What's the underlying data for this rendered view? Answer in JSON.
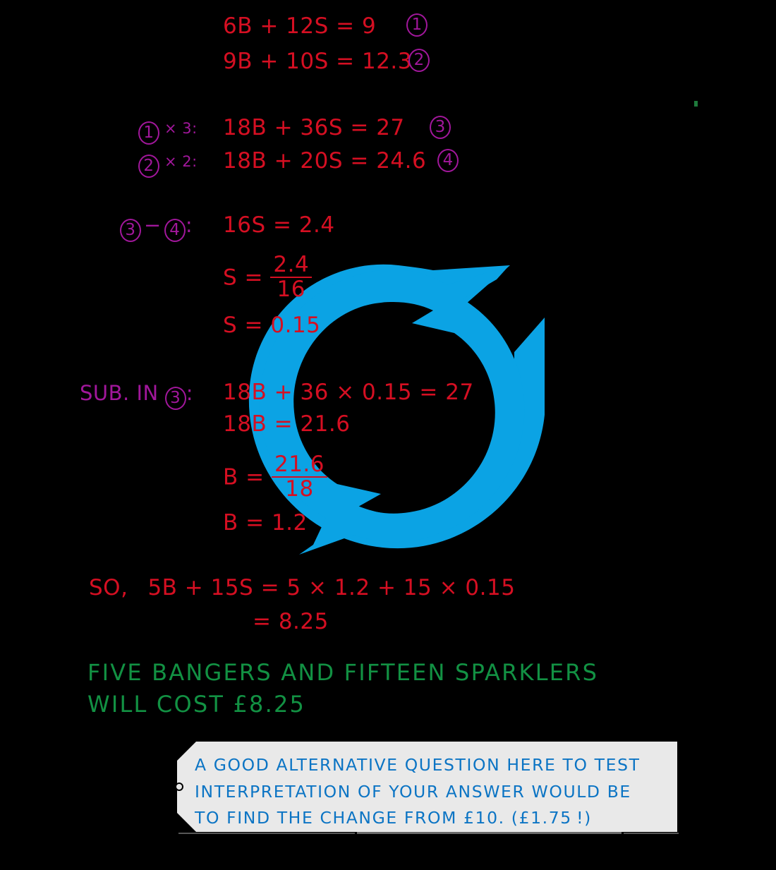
{
  "colors": {
    "background": "#000000",
    "red": "#D50F22",
    "purple": "#A1179B",
    "green": "#129143",
    "note_blue": "#0B74C4",
    "note_bg": "#E9E9E9",
    "logo_blue": "#0BA3E4"
  },
  "work": {
    "eq1": "6B + 12S = 9",
    "eq1_ref": "1",
    "eq2": "9B + 10S = 12.3",
    "eq2_ref": "2",
    "op1_ref": "1",
    "op1_mult": "× 3:",
    "eq3": "18B + 36S = 27",
    "eq3_ref": "3",
    "op2_ref": "2",
    "op2_mult": "× 2:",
    "eq4": "18B + 20S = 24.6",
    "eq4_ref": "4",
    "sub_ref_a": "3",
    "sub_minus": "−",
    "sub_ref_b": "4",
    "sub_colon": ":",
    "eq5": "16S = 2.4",
    "s_frac_lhs": "S =",
    "s_frac_num": "2.4",
    "s_frac_den": "16",
    "s_value": "S = 0.15",
    "subin_label": "SUB. IN",
    "subin_ref": "3",
    "subin_colon": ":",
    "eq6": "18B + 36 × 0.15 = 27",
    "eq7": "18B = 21.6",
    "b_frac_lhs": "B =",
    "b_frac_num": "21.6",
    "b_frac_den": "18",
    "b_value": "B = 1.2",
    "so_label": "SO,",
    "so_eq": "5B + 15S = 5 × 1.2 + 15 × 0.15",
    "so_result": "= 8.25"
  },
  "answer": {
    "line1": "FIVE  BANGERS  AND  FIFTEEN  SPARKLERS",
    "line2": "WILL  COST  £8.25"
  },
  "note": {
    "line1": "A  GOOD  ALTERNATIVE  QUESTION  HERE  TO  TEST",
    "line2": "INTERPRETATION  OF  YOUR  ANSWER  WOULD  BE",
    "line3": "TO  FIND  THE  CHANGE  FROM  £10.  (£1.75 !)"
  },
  "logo": {
    "icon": "circular-refresh-arrows"
  }
}
